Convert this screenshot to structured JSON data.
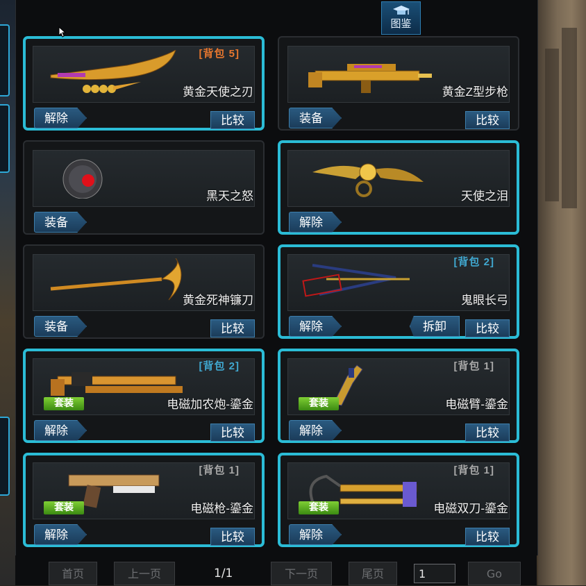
{
  "header": {
    "gallery_label": "图鉴"
  },
  "items": [
    {
      "name": "黄金天使之刃",
      "badge": "背包 5",
      "badge_color": "orange",
      "selected": true,
      "primary_label": "解除",
      "compare_label": "比较"
    },
    {
      "name": "黄金Z型步枪",
      "badge": "",
      "selected": false,
      "primary_label": "装备",
      "compare_label": "比较"
    },
    {
      "name": "黑天之怒",
      "badge": "",
      "selected": false,
      "primary_label": "装备",
      "compare_label": ""
    },
    {
      "name": "天使之泪",
      "badge": "",
      "selected": true,
      "primary_label": "解除",
      "compare_label": ""
    },
    {
      "name": "黄金死神镰刀",
      "badge": "",
      "selected": false,
      "primary_label": "装备",
      "compare_label": "比较"
    },
    {
      "name": "鬼眼长弓",
      "badge": "背包 2",
      "badge_color": "blue",
      "selected": true,
      "primary_label": "解除",
      "extra_label": "拆卸",
      "compare_label": "比较"
    },
    {
      "name": "电磁加农炮-鎏金",
      "badge": "背包 2",
      "badge_color": "blue",
      "selected": true,
      "suit_label": "套装",
      "primary_label": "解除",
      "compare_label": "比较"
    },
    {
      "name": "电磁臂-鎏金",
      "badge": "背包 1",
      "badge_color": "gray",
      "selected": true,
      "suit_label": "套装",
      "primary_label": "解除",
      "compare_label": "比较"
    },
    {
      "name": "电磁枪-鎏金",
      "badge": "背包 1",
      "badge_color": "gray",
      "selected": true,
      "suit_label": "套装",
      "primary_label": "解除",
      "compare_label": "比较"
    },
    {
      "name": "电磁双刀-鎏金",
      "badge": "背包 1",
      "badge_color": "gray",
      "selected": true,
      "suit_label": "套装",
      "primary_label": "解除",
      "compare_label": "比较"
    }
  ],
  "pager": {
    "first": "首页",
    "prev": "上一页",
    "info": "1/1",
    "next": "下一页",
    "last": "尾页",
    "page_value": "1",
    "go": "Go"
  },
  "colors": {
    "selected_border": "#2bbcd6",
    "button": "#1b3c5a",
    "suit": "#5aa81e"
  }
}
